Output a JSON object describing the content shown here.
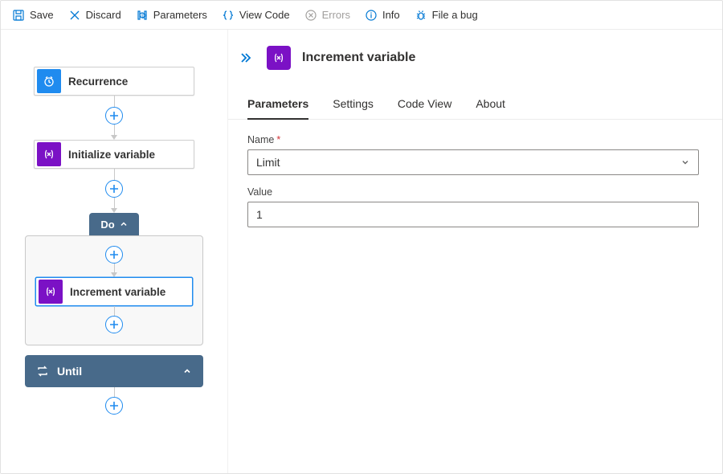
{
  "toolbar": {
    "save": "Save",
    "discard": "Discard",
    "parameters": "Parameters",
    "viewcode": "View Code",
    "errors": "Errors",
    "info": "Info",
    "bug": "File a bug"
  },
  "flow": {
    "recurrence": "Recurrence",
    "init": "Initialize variable",
    "do": "Do",
    "increment": "Increment variable",
    "until": "Until"
  },
  "panel": {
    "title": "Increment variable",
    "tabs": {
      "parameters": "Parameters",
      "settings": "Settings",
      "codeview": "Code View",
      "about": "About"
    },
    "form": {
      "name_label": "Name",
      "name_value": "Limit",
      "value_label": "Value",
      "value_value": "1"
    }
  }
}
